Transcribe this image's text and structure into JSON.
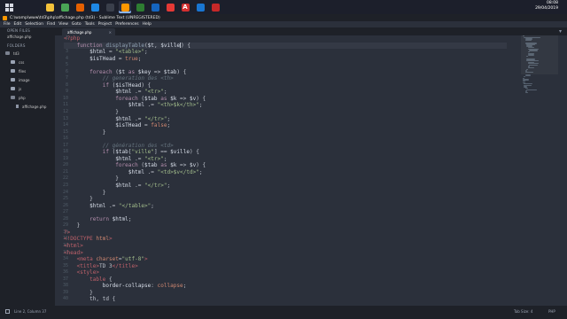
{
  "colors": {
    "keyword": "#b48ead",
    "string": "#a3be8c",
    "variable": "#d8dee9",
    "function": "#8fa1b3",
    "plain": "#c0c5ce",
    "comment": "#65737e",
    "tag": "#bf616a",
    "attribute": "#d08770",
    "number": "#d08770"
  },
  "taskbar": {
    "clock_time": "08:08",
    "clock_date": "29/04/2019",
    "apps": [
      {
        "name": "file-explorer-icon",
        "letter": "",
        "color": "#f4c23a"
      },
      {
        "name": "chrome-icon",
        "letter": "",
        "color": "#4aa556"
      },
      {
        "name": "firefox-icon",
        "letter": "",
        "color": "#e66000"
      },
      {
        "name": "app-icon-blue",
        "letter": "",
        "color": "#1e88e5"
      },
      {
        "name": "app-icon-dark",
        "letter": "",
        "color": "#3a3f4b"
      },
      {
        "name": "sublime-text-icon",
        "letter": "",
        "color": "#ff9800"
      },
      {
        "name": "app-icon-green",
        "letter": "",
        "color": "#2e7d32"
      },
      {
        "name": "app-icon-blue2",
        "letter": "",
        "color": "#1565c0"
      },
      {
        "name": "wamp-icon",
        "letter": "",
        "color": "#e53935"
      },
      {
        "name": "adobe-icon",
        "letter": "A",
        "color": "#d32f2f"
      },
      {
        "name": "app-icon-blue3",
        "letter": "",
        "color": "#1976d2"
      },
      {
        "name": "app-icon-red",
        "letter": "",
        "color": "#c62828"
      }
    ]
  },
  "window": {
    "title": "C:\\wamp\\www\\td3\\php\\affichage.php (td3) - Sublime Text (UNREGISTERED)"
  },
  "menu": [
    "File",
    "Edit",
    "Selection",
    "Find",
    "View",
    "Goto",
    "Tools",
    "Project",
    "Preferences",
    "Help"
  ],
  "sidebar": {
    "open_files_header": "OPEN FILES",
    "open_files": [
      "affichage.php"
    ],
    "folders_header": "FOLDERS",
    "items": [
      {
        "label": "td3",
        "type": "folder-open",
        "indent": 1
      },
      {
        "label": "css",
        "type": "folder",
        "indent": 2
      },
      {
        "label": "files",
        "type": "folder",
        "indent": 2
      },
      {
        "label": "image",
        "type": "folder",
        "indent": 2
      },
      {
        "label": "js",
        "type": "folder",
        "indent": 2
      },
      {
        "label": "php",
        "type": "folder-open",
        "indent": 2
      },
      {
        "label": "affichage.php",
        "type": "file",
        "indent": 3
      }
    ]
  },
  "tab": {
    "label": "affichage.php",
    "close": "×"
  },
  "editor": {
    "current_line": 2,
    "lines": [
      [
        [
          "<?php",
          "tag"
        ]
      ],
      [
        [
          "    ",
          "plain"
        ],
        [
          "function",
          "keyword"
        ],
        [
          " ",
          "plain"
        ],
        [
          "displayTable",
          "function"
        ],
        [
          "(",
          "plain"
        ],
        [
          "$t",
          "variable"
        ],
        [
          ", ",
          "plain"
        ],
        [
          "$ville",
          "variable"
        ],
        [
          "CURSOR",
          "cursor"
        ],
        [
          ") {",
          "plain"
        ]
      ],
      [
        [
          "        ",
          "plain"
        ],
        [
          "$html",
          "variable"
        ],
        [
          " = ",
          "plain"
        ],
        [
          "\"<table>\"",
          "string"
        ],
        [
          ";",
          "plain"
        ]
      ],
      [
        [
          "        ",
          "plain"
        ],
        [
          "$isTHead",
          "variable"
        ],
        [
          " = ",
          "plain"
        ],
        [
          "true",
          "number"
        ],
        [
          ";",
          "plain"
        ]
      ],
      [
        [
          "",
          "plain"
        ]
      ],
      [
        [
          "        ",
          "plain"
        ],
        [
          "foreach",
          "keyword"
        ],
        [
          " (",
          "plain"
        ],
        [
          "$t",
          "variable"
        ],
        [
          " as ",
          "keyword"
        ],
        [
          "$key",
          "variable"
        ],
        [
          " => ",
          "plain"
        ],
        [
          "$tab",
          "variable"
        ],
        [
          ") {",
          "plain"
        ]
      ],
      [
        [
          "            ",
          "plain"
        ],
        [
          "// generation des <th>",
          "comment"
        ]
      ],
      [
        [
          "            ",
          "plain"
        ],
        [
          "if",
          "keyword"
        ],
        [
          " (",
          "plain"
        ],
        [
          "$isTHead",
          "variable"
        ],
        [
          ") {",
          "plain"
        ]
      ],
      [
        [
          "                ",
          "plain"
        ],
        [
          "$html",
          "variable"
        ],
        [
          " .= ",
          "plain"
        ],
        [
          "\"<tr>\"",
          "string"
        ],
        [
          ";",
          "plain"
        ]
      ],
      [
        [
          "                ",
          "plain"
        ],
        [
          "foreach",
          "keyword"
        ],
        [
          " (",
          "plain"
        ],
        [
          "$tab",
          "variable"
        ],
        [
          " as ",
          "keyword"
        ],
        [
          "$k",
          "variable"
        ],
        [
          " => ",
          "plain"
        ],
        [
          "$v",
          "variable"
        ],
        [
          ") {",
          "plain"
        ]
      ],
      [
        [
          "                    ",
          "plain"
        ],
        [
          "$html",
          "variable"
        ],
        [
          " .= ",
          "plain"
        ],
        [
          "\"<th>$k</th>\"",
          "string"
        ],
        [
          ";",
          "plain"
        ]
      ],
      [
        [
          "                ",
          "plain"
        ],
        [
          "}",
          "plain"
        ]
      ],
      [
        [
          "                ",
          "plain"
        ],
        [
          "$html",
          "variable"
        ],
        [
          " .= ",
          "plain"
        ],
        [
          "\"</tr>\"",
          "string"
        ],
        [
          ";",
          "plain"
        ]
      ],
      [
        [
          "                ",
          "plain"
        ],
        [
          "$isTHead",
          "variable"
        ],
        [
          " = ",
          "plain"
        ],
        [
          "false",
          "number"
        ],
        [
          ";",
          "plain"
        ]
      ],
      [
        [
          "            ",
          "plain"
        ],
        [
          "}",
          "plain"
        ]
      ],
      [
        [
          "",
          "plain"
        ]
      ],
      [
        [
          "            ",
          "plain"
        ],
        [
          "// génération des <td>",
          "comment"
        ]
      ],
      [
        [
          "            ",
          "plain"
        ],
        [
          "if",
          "keyword"
        ],
        [
          " (",
          "plain"
        ],
        [
          "$tab",
          "variable"
        ],
        [
          "[",
          "plain"
        ],
        [
          "\"ville\"",
          "string"
        ],
        [
          "] == ",
          "plain"
        ],
        [
          "$ville",
          "variable"
        ],
        [
          ") {",
          "plain"
        ]
      ],
      [
        [
          "                ",
          "plain"
        ],
        [
          "$html",
          "variable"
        ],
        [
          " .= ",
          "plain"
        ],
        [
          "\"<tr>\"",
          "string"
        ],
        [
          ";",
          "plain"
        ]
      ],
      [
        [
          "                ",
          "plain"
        ],
        [
          "foreach",
          "keyword"
        ],
        [
          " (",
          "plain"
        ],
        [
          "$tab",
          "variable"
        ],
        [
          " as ",
          "keyword"
        ],
        [
          "$k",
          "variable"
        ],
        [
          " => ",
          "plain"
        ],
        [
          "$v",
          "variable"
        ],
        [
          ") {",
          "plain"
        ]
      ],
      [
        [
          "                    ",
          "plain"
        ],
        [
          "$html",
          "variable"
        ],
        [
          " .= ",
          "plain"
        ],
        [
          "\"<td>$v</td>\"",
          "string"
        ],
        [
          ";",
          "plain"
        ]
      ],
      [
        [
          "                ",
          "plain"
        ],
        [
          "}",
          "plain"
        ]
      ],
      [
        [
          "                ",
          "plain"
        ],
        [
          "$html",
          "variable"
        ],
        [
          " .= ",
          "plain"
        ],
        [
          "\"</tr>\"",
          "string"
        ],
        [
          ";",
          "plain"
        ]
      ],
      [
        [
          "            ",
          "plain"
        ],
        [
          "}",
          "plain"
        ]
      ],
      [
        [
          "        ",
          "plain"
        ],
        [
          "}",
          "plain"
        ]
      ],
      [
        [
          "        ",
          "plain"
        ],
        [
          "$html",
          "variable"
        ],
        [
          " .= ",
          "plain"
        ],
        [
          "\"</table>\"",
          "string"
        ],
        [
          ";",
          "plain"
        ]
      ],
      [
        [
          "",
          "plain"
        ]
      ],
      [
        [
          "        ",
          "plain"
        ],
        [
          "return",
          "keyword"
        ],
        [
          " ",
          "plain"
        ],
        [
          "$html",
          "variable"
        ],
        [
          ";",
          "plain"
        ]
      ],
      [
        [
          "    ",
          "plain"
        ],
        [
          "}",
          "plain"
        ]
      ],
      [
        [
          "?>",
          "tag"
        ]
      ],
      [
        [
          "<!DOCTYPE ",
          "tag"
        ],
        [
          "html",
          "attribute"
        ],
        [
          ">",
          "tag"
        ]
      ],
      [
        [
          "<html>",
          "tag"
        ]
      ],
      [
        [
          "<head>",
          "tag"
        ]
      ],
      [
        [
          "    ",
          "plain"
        ],
        [
          "<meta ",
          "tag"
        ],
        [
          "charset",
          "attribute"
        ],
        [
          "=",
          "plain"
        ],
        [
          "\"utf-8\"",
          "string"
        ],
        [
          ">",
          "tag"
        ]
      ],
      [
        [
          "    ",
          "plain"
        ],
        [
          "<title>",
          "tag"
        ],
        [
          "TD 3",
          "plain"
        ],
        [
          "</title>",
          "tag"
        ]
      ],
      [
        [
          "    ",
          "plain"
        ],
        [
          "<style>",
          "tag"
        ]
      ],
      [
        [
          "        ",
          "plain"
        ],
        [
          "table",
          "tag"
        ],
        [
          " {",
          "plain"
        ]
      ],
      [
        [
          "            ",
          "plain"
        ],
        [
          "border-collapse",
          "variable"
        ],
        [
          ": ",
          "plain"
        ],
        [
          "collapse",
          "attribute"
        ],
        [
          ";",
          "plain"
        ]
      ],
      [
        [
          "        ",
          "plain"
        ],
        [
          "}",
          "plain"
        ]
      ],
      [
        [
          "        ",
          "plain"
        ],
        [
          "th, td {",
          "plain"
        ]
      ]
    ]
  },
  "statusbar": {
    "position": "Line 2, Column 37",
    "tab_size": "Tab Size: 4",
    "syntax": "PHP"
  }
}
